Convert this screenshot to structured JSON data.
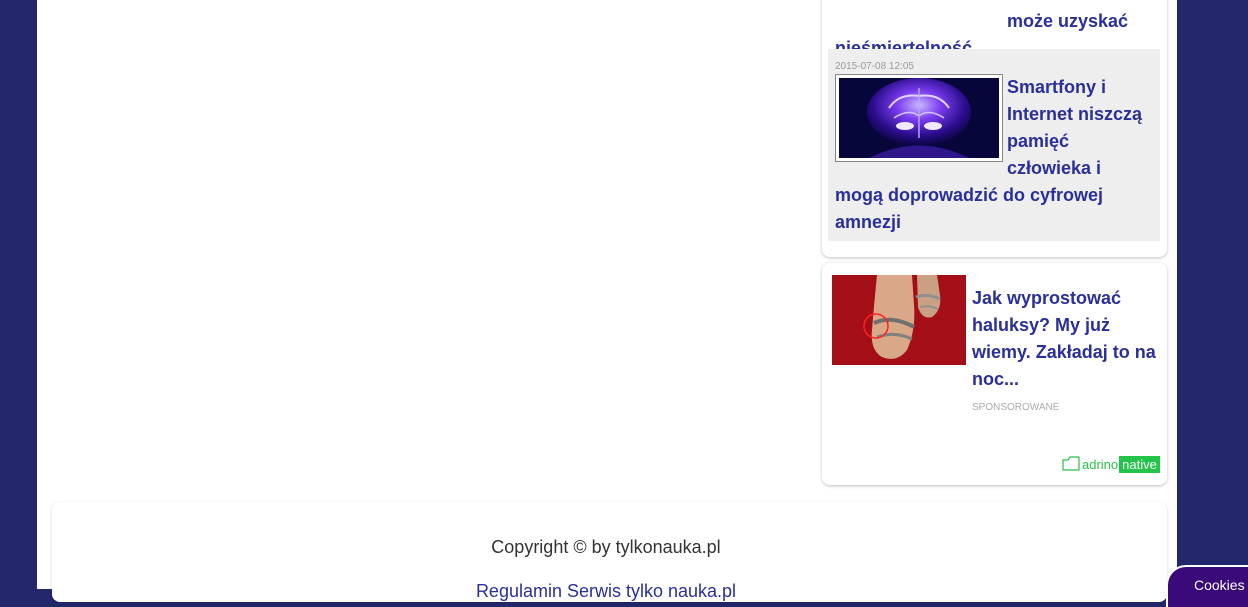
{
  "sidebar": {
    "previous_article": {
      "title_line1": "może uzyskać",
      "title_line2": "nieśmiertelność"
    },
    "article": {
      "date": "2015-07-08 12:05",
      "title": "Smartfony i Internet niszczą pamięć człowieka i mogą doprowadzić do cyfrowej amnezji",
      "thumb_icon": "brain-image"
    },
    "ad": {
      "title": "Jak wyprostować haluksy? My już wiemy. Zakładaj to na noc...",
      "sponsored_label": "SPONSOROWANE",
      "image_icon": "feet-sandals-image",
      "logo_text": "adrino",
      "logo_badge": "native"
    }
  },
  "footer": {
    "copyright": "Copyright © by tylkonauka.pl",
    "links_text": "Regulamin Serwis tylko nauka.pl"
  },
  "cookies": {
    "label": "Cookies"
  },
  "colors": {
    "background": "#23286d",
    "link": "#2a2f9a",
    "brand_green": "#22c44a"
  }
}
